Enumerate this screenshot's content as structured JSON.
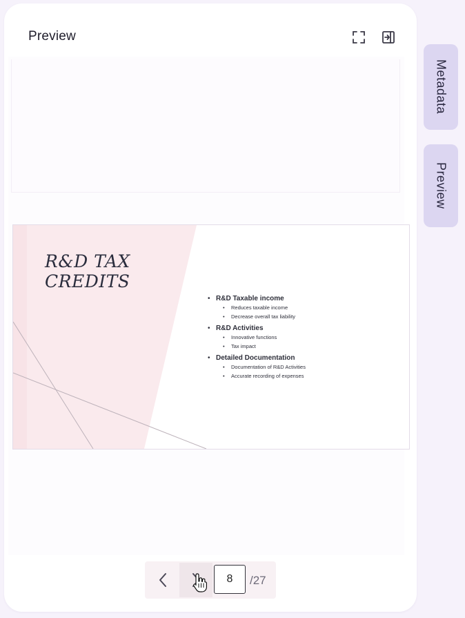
{
  "panel": {
    "title": "Preview",
    "fullscreen_icon": "fullscreen-icon",
    "collapse_icon": "collapse-panel-icon"
  },
  "slide": {
    "title_line1": "R&D TAX",
    "title_line2": "CREDITS",
    "bullets": [
      {
        "label": "R&D Taxable income",
        "subs": [
          "Reduces taxable income",
          "Decrease overall tax liability"
        ]
      },
      {
        "label": "R&D Activities",
        "subs": [
          "Innovative functions",
          "Tax impact"
        ]
      },
      {
        "label": "Detailed Documentation",
        "subs": [
          "Documentation of R&D Activities",
          "Accurate recording of expenses"
        ]
      }
    ]
  },
  "pager": {
    "prev_icon": "chevron-left-icon",
    "next_icon": "chevron-right-icon",
    "current_page": "8",
    "total": "/27"
  },
  "side_tabs": {
    "metadata": "Metadata",
    "preview": "Preview"
  },
  "colors": {
    "page_bg": "#f6f2fb",
    "tab_bg": "#dcd6f1",
    "slide_accent": "#f9e6ea"
  }
}
